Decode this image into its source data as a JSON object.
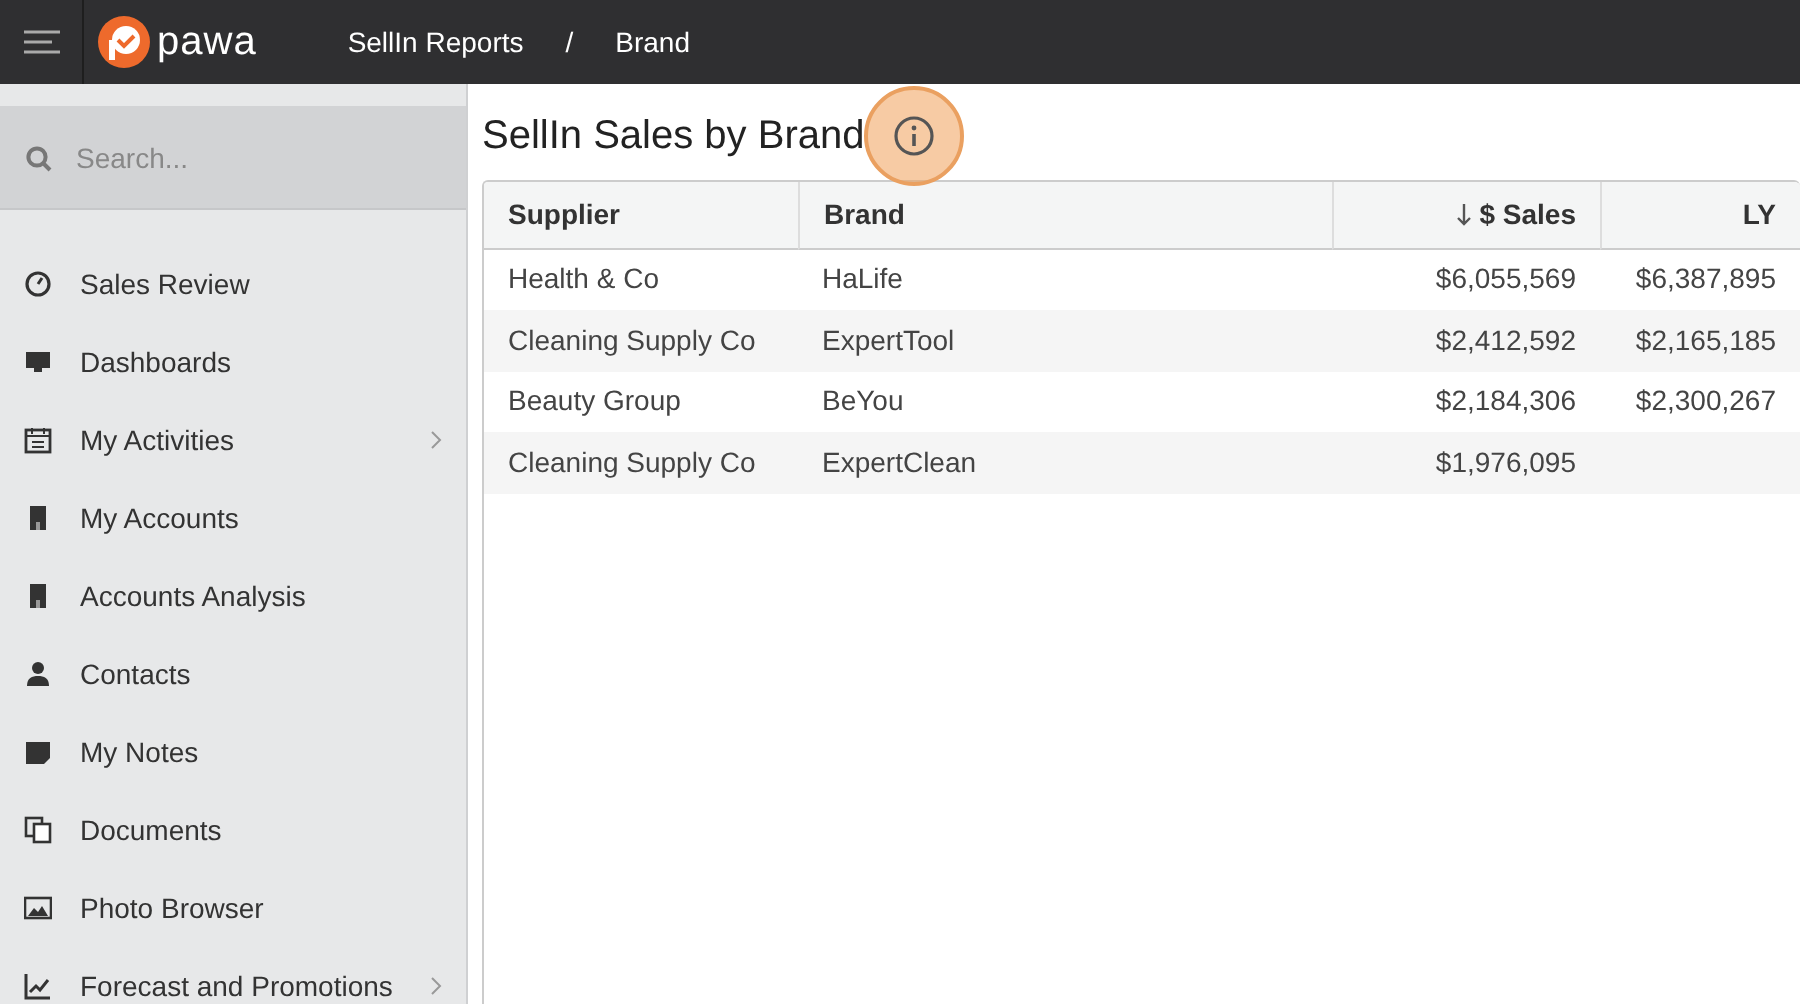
{
  "header": {
    "logo_text": "pawa",
    "breadcrumbs": [
      "SellIn Reports",
      "/",
      "Brand"
    ]
  },
  "sidebar": {
    "search": {
      "placeholder": "Search..."
    },
    "items": [
      {
        "label": "Sales Review",
        "has_submenu": false
      },
      {
        "label": "Dashboards",
        "has_submenu": false
      },
      {
        "label": "My Activities",
        "has_submenu": true
      },
      {
        "label": "My Accounts",
        "has_submenu": false
      },
      {
        "label": "Accounts Analysis",
        "has_submenu": false
      },
      {
        "label": "Contacts",
        "has_submenu": false
      },
      {
        "label": "My Notes",
        "has_submenu": false
      },
      {
        "label": "Documents",
        "has_submenu": false
      },
      {
        "label": "Photo Browser",
        "has_submenu": false
      },
      {
        "label": "Forecast and Promotions",
        "has_submenu": true
      }
    ]
  },
  "page": {
    "title": "SellIn Sales by Brand",
    "info_highlighted": true
  },
  "table": {
    "columns": [
      {
        "label": "Supplier",
        "sorted": false
      },
      {
        "label": "Brand",
        "sorted": false
      },
      {
        "label": "$ Sales",
        "sorted": true
      },
      {
        "label": "LY",
        "sorted": false
      }
    ],
    "rows": [
      [
        "Health & Co",
        "HaLife",
        "$6,055,569",
        "$6,387,895"
      ],
      [
        "Cleaning Supply Co",
        "ExpertTool",
        "$2,412,592",
        "$2,165,185"
      ],
      [
        "Beauty Group",
        "BeYou",
        "$2,184,306",
        "$2,300,267"
      ],
      [
        "Cleaning Supply Co",
        "ExpertClean",
        "$1,976,095"
      ]
    ]
  }
}
